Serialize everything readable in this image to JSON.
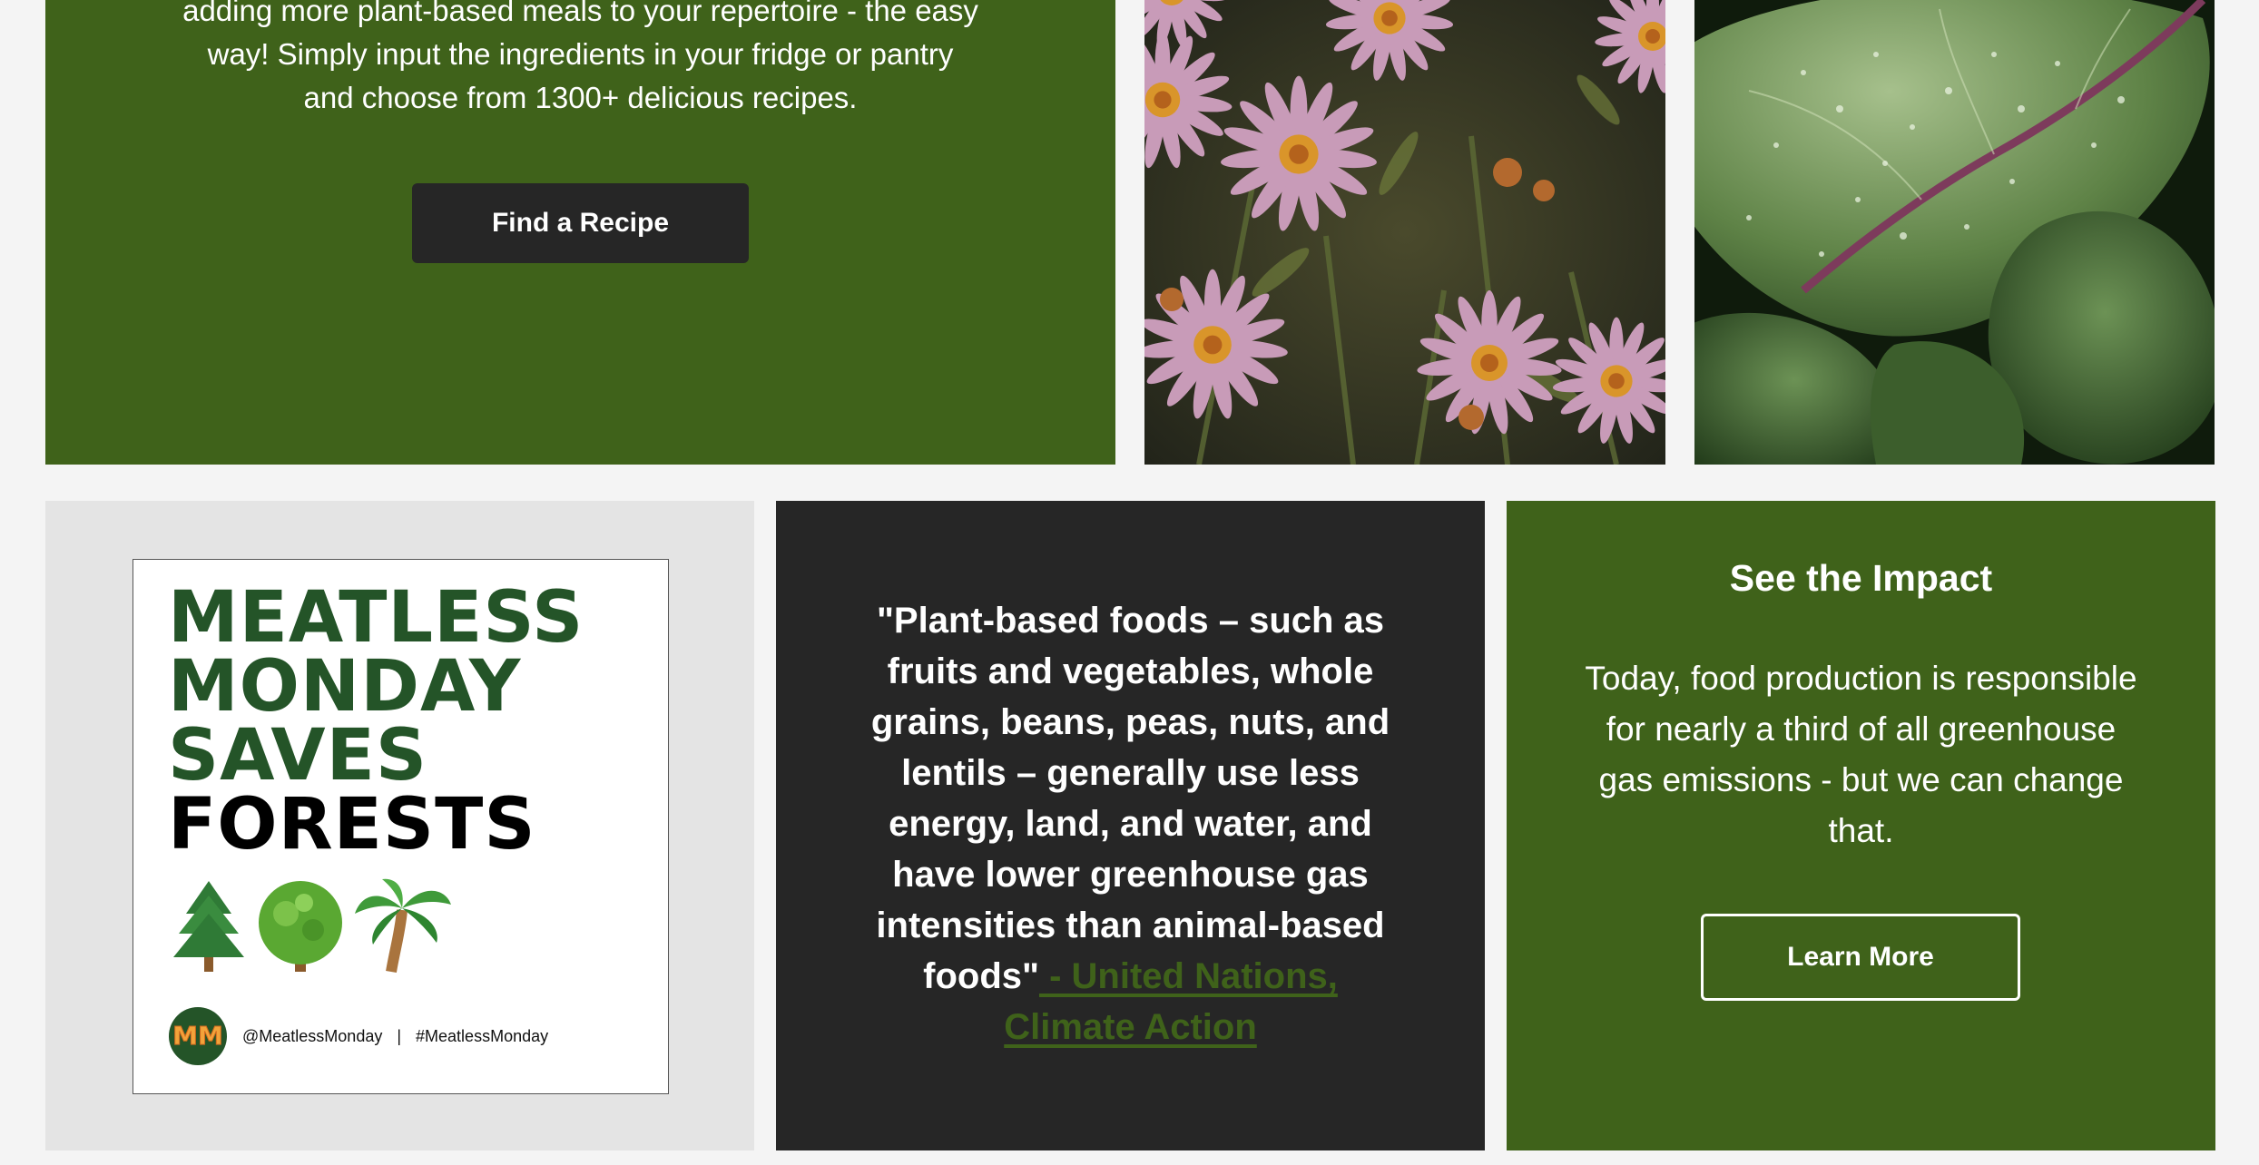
{
  "hero": {
    "lines": [
      "adding more plant-based meals to your repertoire - the easy",
      "way! Simply input the ingredients in your fridge or pantry",
      "and choose from 1300+ delicious recipes."
    ],
    "button_label": "Find a Recipe"
  },
  "images": {
    "flowers_alt": "pink aster flowers",
    "greens_alt": "leafy greens with water droplets"
  },
  "promo": {
    "title_lines": [
      "MEATLESS",
      "MONDAY",
      "SAVES",
      "FORESTS"
    ],
    "emojis": [
      "evergreen-tree",
      "deciduous-tree",
      "palm-tree"
    ],
    "logo_text": "MM",
    "handle": "@MeatlessMonday",
    "separator": "|",
    "hashtag": "#MeatlessMonday",
    "title_color": "#245428"
  },
  "quote": {
    "text": "\"Plant-based foods – such as fruits and vegetables, whole grains, beans, peas, nuts, and lentils – generally use less energy, land, and water, and have lower greenhouse gas intensities than animal-based foods\"",
    "source_link": " - United Nations, Climate Action"
  },
  "impact": {
    "title": "See the Impact",
    "body": "Today, food production is responsible for nearly a third of all greenhouse gas emissions - but we can change that.",
    "button_label": "Learn More"
  },
  "colors": {
    "brand_green": "#3f621a",
    "dark": "#262626",
    "page_bg": "#f4f4f4"
  }
}
